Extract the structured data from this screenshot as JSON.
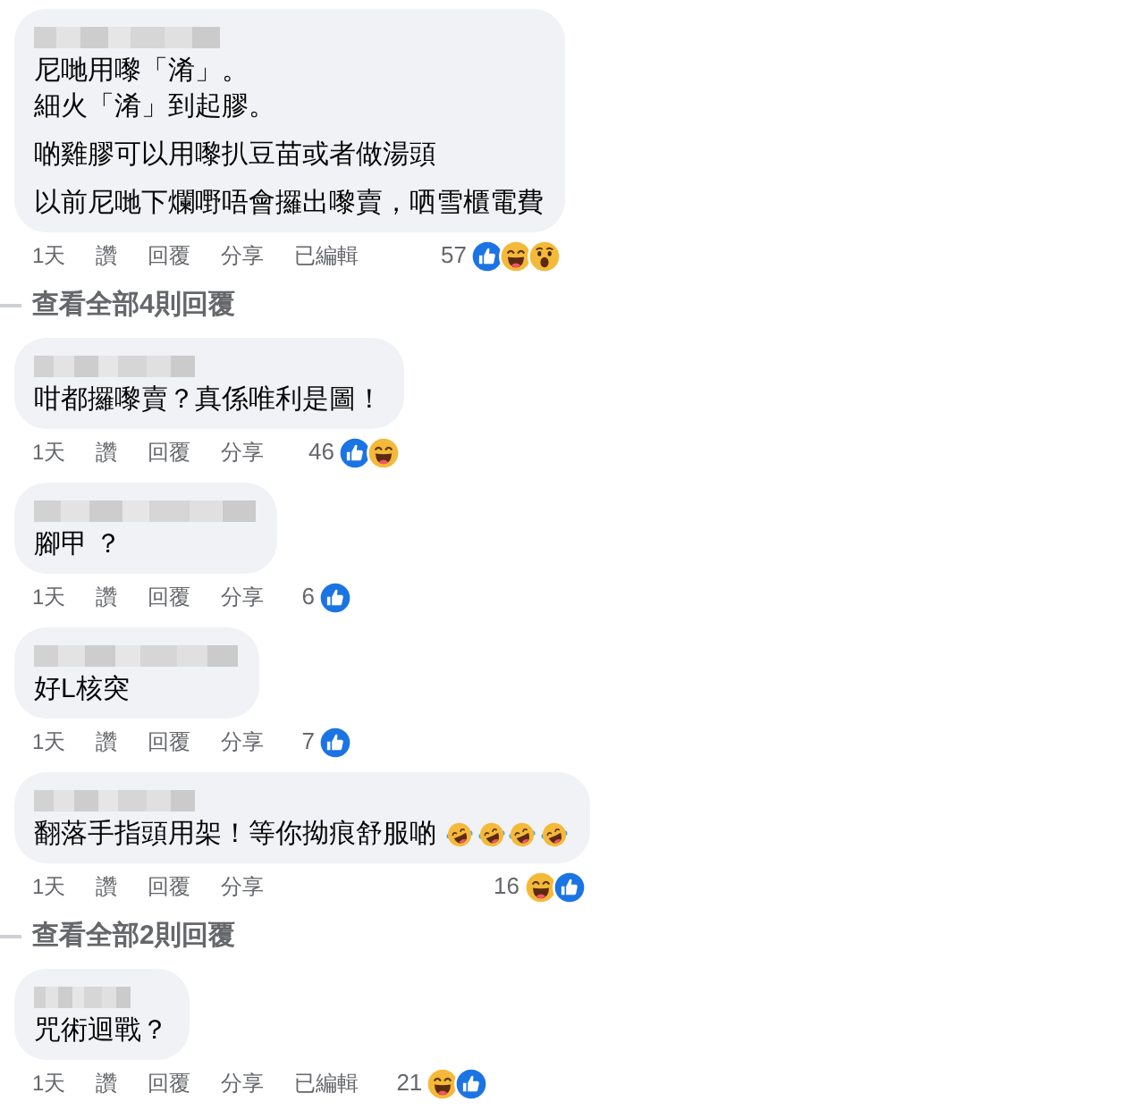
{
  "comments": [
    {
      "paragraphs": [
        [
          "尼哋用嚟「淆」。",
          "細火「淆」到起膠。"
        ],
        [
          "啲雞膠可以用嚟扒豆苗或者做湯頭"
        ],
        [
          "以前尼哋下爛嘢唔會攞出嚟賣，哂雪櫃電費"
        ]
      ],
      "time": "1天",
      "actions": [
        "讚",
        "回覆",
        "分享"
      ],
      "edited": "已編輯",
      "reactions": {
        "count": "57",
        "icons": [
          {
            "kind": "like"
          },
          {
            "kind": "haha"
          },
          {
            "kind": "wow"
          }
        ]
      },
      "view_replies": "查看全部4則回覆"
    },
    {
      "paragraphs": [
        [
          "咁都攞嚟賣？真係唯利是圖！"
        ]
      ],
      "time": "1天",
      "actions": [
        "讚",
        "回覆",
        "分享"
      ],
      "reactions": {
        "count": "46",
        "icons": [
          {
            "kind": "like"
          },
          {
            "kind": "haha"
          }
        ]
      }
    },
    {
      "paragraphs": [
        [
          "腳甲 ？"
        ]
      ],
      "time": "1天",
      "actions": [
        "讚",
        "回覆",
        "分享"
      ],
      "reactions": {
        "count": "6",
        "icons": [
          {
            "kind": "like"
          }
        ]
      }
    },
    {
      "paragraphs": [
        [
          "好L核突"
        ]
      ],
      "time": "1天",
      "actions": [
        "讚",
        "回覆",
        "分享"
      ],
      "reactions": {
        "count": "7",
        "icons": [
          {
            "kind": "like"
          }
        ]
      }
    },
    {
      "paragraphs": [
        [
          "翻落手指頭用架！等你拗痕舒服啲"
        ]
      ],
      "emojis": [
        {
          "kind": "rofl"
        },
        {
          "kind": "rofl"
        },
        {
          "kind": "rofl"
        },
        {
          "kind": "rofl"
        }
      ],
      "time": "1天",
      "actions": [
        "讚",
        "回覆",
        "分享"
      ],
      "reactions": {
        "count": "16",
        "icons": [
          {
            "kind": "haha"
          },
          {
            "kind": "like"
          }
        ]
      },
      "view_replies": "查看全部2則回覆"
    },
    {
      "paragraphs": [
        [
          "咒術迴戰？"
        ]
      ],
      "time": "1天",
      "actions": [
        "讚",
        "回覆",
        "分享"
      ],
      "edited": "已編輯",
      "reactions": {
        "count": "21",
        "icons": [
          {
            "kind": "haha"
          },
          {
            "kind": "like"
          }
        ]
      }
    }
  ]
}
